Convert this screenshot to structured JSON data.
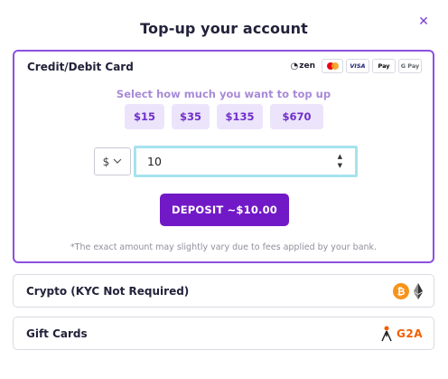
{
  "modal": {
    "title": "Top-up your account",
    "close_glyph": "✕"
  },
  "card_section": {
    "title": "Credit/Debit Card",
    "payment_logos": {
      "zen": "zen",
      "visa": "VISA",
      "apple_pay": "Pay",
      "google_pay": "G Pay"
    },
    "subtitle": "Select how much you want to top up",
    "amounts": [
      "$15",
      "$35",
      "$135",
      "$670"
    ],
    "currency": "$",
    "amount_value": "10",
    "deposit_label": "DEPOSIT ~$10.00",
    "note": "*The exact amount may slightly vary due to fees applied by your bank."
  },
  "crypto_section": {
    "label": "Crypto (KYC Not Required)",
    "btc_glyph": "₿",
    "icons": [
      "bitcoin-icon",
      "ethereum-icon"
    ]
  },
  "gift_section": {
    "label": "Gift Cards",
    "brand": "G2A",
    "icons": [
      "g2a-logo"
    ]
  },
  "colors": {
    "accent": "#7219c7",
    "accent_border": "#8c50e0",
    "chip_bg": "#ece4fb",
    "chip_text": "#6f2fc9",
    "input_focus": "#a6e3ee",
    "btc": "#f7931a",
    "g2a": "#f05f00"
  }
}
